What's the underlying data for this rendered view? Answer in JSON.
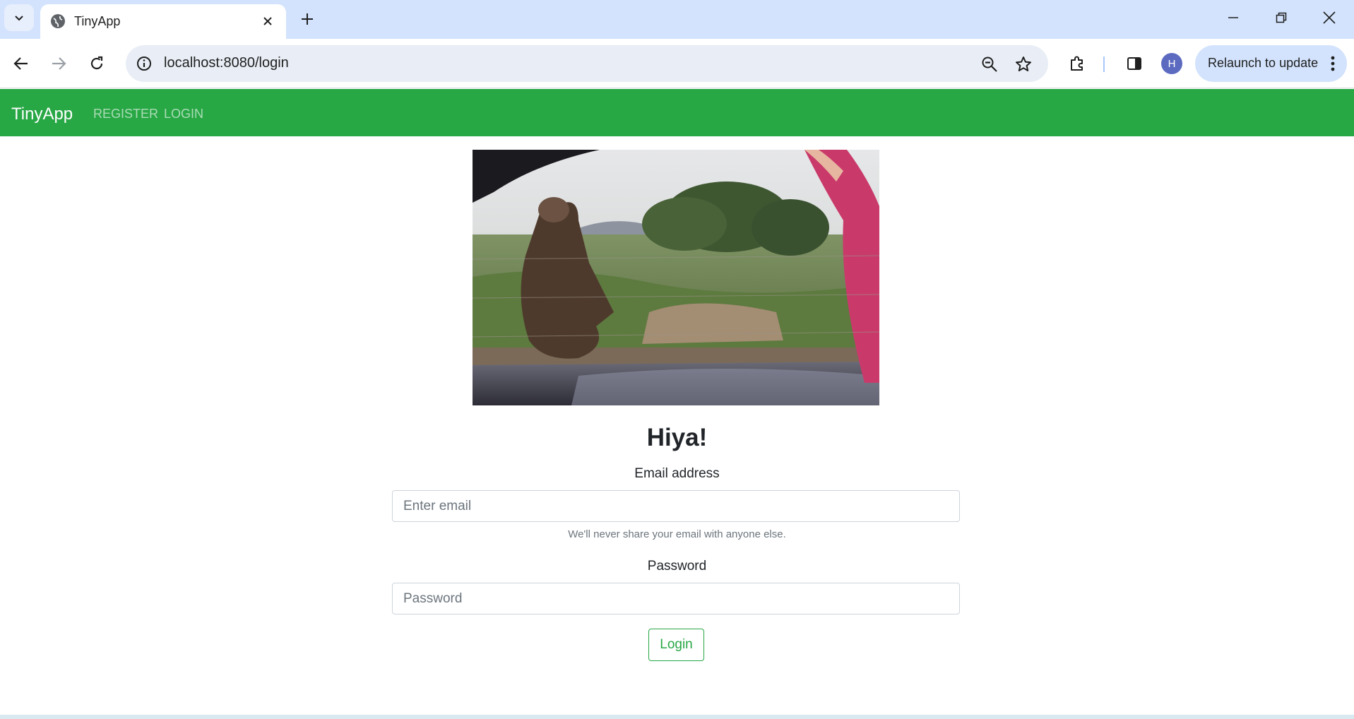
{
  "browser": {
    "tab_title": "TinyApp",
    "url": "localhost:8080/login",
    "profile_initial": "H",
    "relaunch_label": "Relaunch to update"
  },
  "navbar": {
    "brand": "TinyApp",
    "links": [
      "REGISTER",
      "LOGIN"
    ],
    "color": "#28a745"
  },
  "hero_image": {
    "description_icon": "bear-waving-photo"
  },
  "form": {
    "heading": "Hiya!",
    "email_label": "Email address",
    "email_placeholder": "Enter email",
    "email_help": "We'll never share your email with anyone else.",
    "password_label": "Password",
    "password_placeholder": "Password",
    "submit_label": "Login"
  }
}
